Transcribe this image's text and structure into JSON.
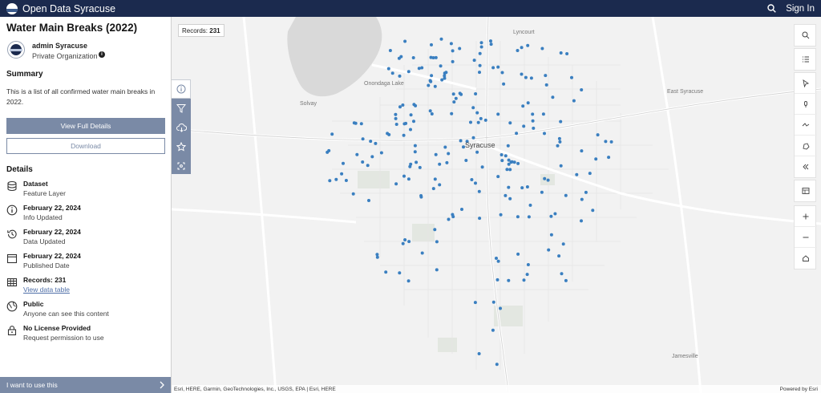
{
  "header": {
    "site_title": "Open Data Syracuse",
    "sign_in": "Sign In"
  },
  "item": {
    "title": "Water Main Breaks (2022)",
    "owner_name": "admin Syracuse",
    "owner_org": "Private Organization"
  },
  "summary": {
    "heading": "Summary",
    "text": "This is a list of all confirmed water main breaks in 2022."
  },
  "buttons": {
    "view_full_details": "View Full Details",
    "download": "Download"
  },
  "details": {
    "heading": "Details",
    "type_label": "Dataset",
    "type_value": "Feature Layer",
    "info_date": "February 22, 2024",
    "info_label": "Info Updated",
    "data_date": "February 22, 2024",
    "data_label": "Data Updated",
    "pub_date": "February 22, 2024",
    "pub_label": "Published Date",
    "records": "Records: 231",
    "records_link": "View data table",
    "access": "Public",
    "access_sub": "Anyone can see this content",
    "license": "No License Provided",
    "license_sub": "Request permission to use"
  },
  "footer": {
    "use_this": "I want to use this"
  },
  "map": {
    "records_badge_label": "Records:",
    "records_badge_value": "231",
    "attribution": "Esri, HERE, Garmin, GeoTechnologies, Inc., USGS, EPA | Esri, HERE",
    "powered_by": "Powered by Esri",
    "point_color": "#3a7fc0",
    "labels": {
      "lyncourt": "Lyncourt",
      "onondaga_lake": "Onondaga Lake",
      "solvay": "Solvay",
      "syracuse": "Syracuse",
      "east_syracuse": "East Syracuse",
      "jamesville": "Jamesville"
    }
  },
  "colors": {
    "topbar": "#1b2a4e",
    "accent": "#7a8aa6",
    "link": "#4f6fa8"
  }
}
